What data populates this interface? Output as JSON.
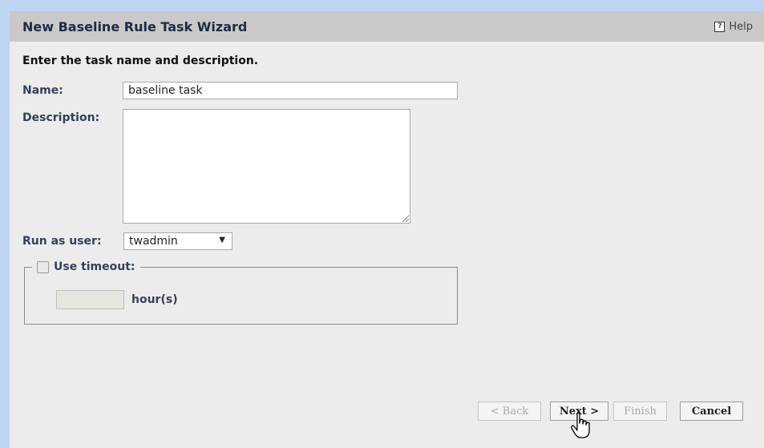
{
  "wizard": {
    "title": "New Baseline Rule Task Wizard",
    "help_label": "Help",
    "help_icon": "?"
  },
  "instructions": "Enter the task name and description.",
  "form": {
    "name_label": "Name:",
    "name_value": "baseline task",
    "description_label": "Description:",
    "description_value": "",
    "run_as_label": "Run as user:",
    "run_as_value": "twadmin",
    "run_as_arrow": "▼",
    "timeout_label": "Use timeout:",
    "timeout_checked": false,
    "timeout_value": "",
    "timeout_unit": "hour(s)"
  },
  "buttons": {
    "back": "< Back",
    "next": "Next >",
    "finish": "Finish",
    "cancel": "Cancel"
  },
  "icons": {
    "help": "help-icon",
    "select_arrow": "chevron-down-icon",
    "resize": "resize-grip-icon",
    "cursor": "hand-pointer-icon"
  }
}
